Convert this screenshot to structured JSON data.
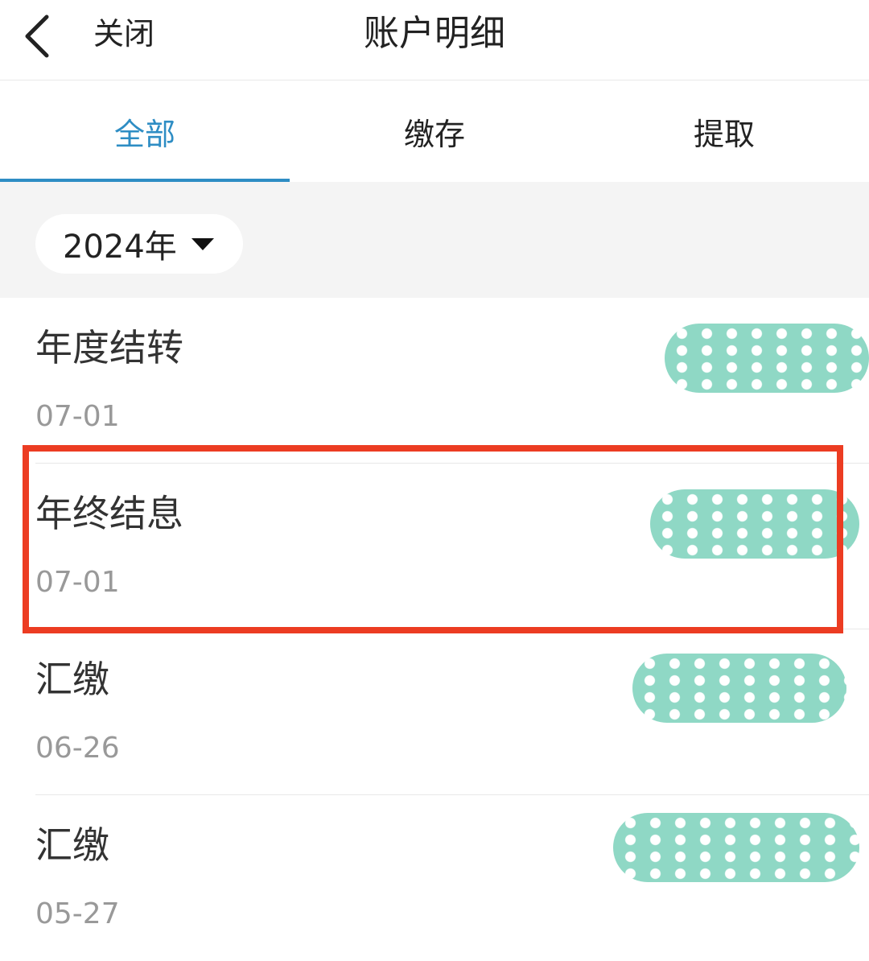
{
  "header": {
    "back_icon": "chevron-left-icon",
    "close_label": "关闭",
    "title": "账户明细"
  },
  "tabs": [
    {
      "label": "全部",
      "active": true
    },
    {
      "label": "缴存",
      "active": false
    },
    {
      "label": "提取",
      "active": false
    }
  ],
  "filter": {
    "year_label": "2024年",
    "dropdown_icon": "caret-down-icon"
  },
  "records": [
    {
      "title": "年度结转",
      "date": "07-01"
    },
    {
      "title": "年终结息",
      "date": "07-01"
    },
    {
      "title": "汇缴",
      "date": "06-26"
    },
    {
      "title": "汇缴",
      "date": "05-27"
    }
  ],
  "colors": {
    "accent": "#2e8dc4",
    "mask": "#8fd8c5",
    "highlight": "#ec3c22"
  }
}
